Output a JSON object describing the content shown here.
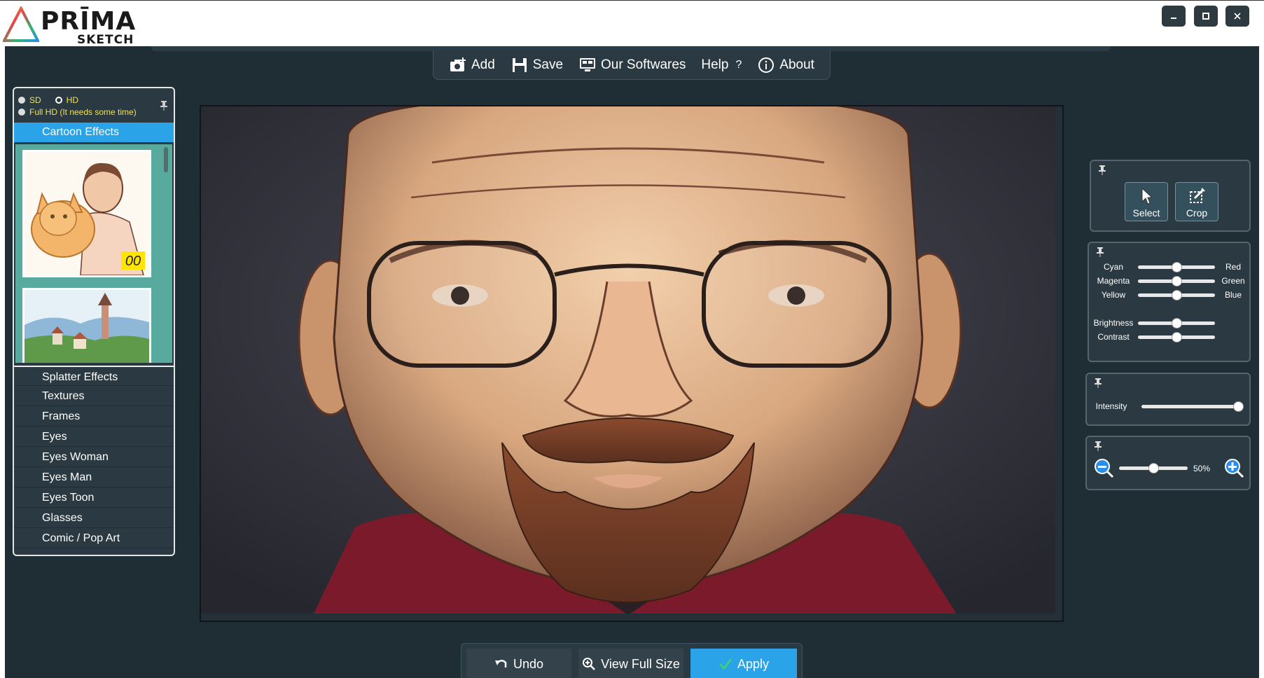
{
  "app": {
    "logo_top": "PRĪMA",
    "logo_bottom": "SKETCH",
    "window_controls": {
      "minimize_icon": "minimize-icon",
      "maximize_icon": "maximize-icon",
      "close_icon": "close-icon"
    }
  },
  "menu": {
    "items": [
      {
        "label": "Add",
        "icon": "camera-add-icon"
      },
      {
        "label": "Save",
        "icon": "floppy-icon"
      },
      {
        "label": "Our Softwares",
        "icon": "software-icon"
      },
      {
        "label": "Help",
        "icon": "question-icon",
        "suffix": "?"
      },
      {
        "label": "About",
        "icon": "info-icon"
      }
    ]
  },
  "left_panel": {
    "quality": {
      "sd": "SD",
      "hd": "HD",
      "full_hd": "Full HD (It needs some time)",
      "selected": "HD"
    },
    "active_category": "Cartoon Effects",
    "thumbnail_badge": "00",
    "categories": [
      "Splatter Effects",
      "Textures",
      "Frames",
      "Eyes",
      "Eyes Woman",
      "Eyes Man",
      "Eyes Toon",
      "Glasses",
      "Comic / Pop Art"
    ]
  },
  "tools": {
    "select_label": "Select",
    "crop_label": "Crop"
  },
  "color_balance": {
    "rows": [
      {
        "left": "Cyan",
        "right": "Red",
        "value": 0.5
      },
      {
        "left": "Magenta",
        "right": "Green",
        "value": 0.5
      },
      {
        "left": "Yellow",
        "right": "Blue",
        "value": 0.5
      }
    ],
    "brightness": {
      "label": "Brightness",
      "value": 0.5
    },
    "contrast": {
      "label": "Contrast",
      "value": 0.5
    }
  },
  "intensity": {
    "label": "Intensity",
    "value": 1.0
  },
  "zoom": {
    "label": "50%",
    "value": 0.5
  },
  "bottom": {
    "undo": "Undo",
    "view_full": "View Full Size",
    "apply": "Apply"
  },
  "colors": {
    "accent": "#2aa3e8",
    "panel": "#2b3a42",
    "workspace": "#1f2e35",
    "quality_text": "#f0e060",
    "thumb_bg": "#58a99e"
  }
}
